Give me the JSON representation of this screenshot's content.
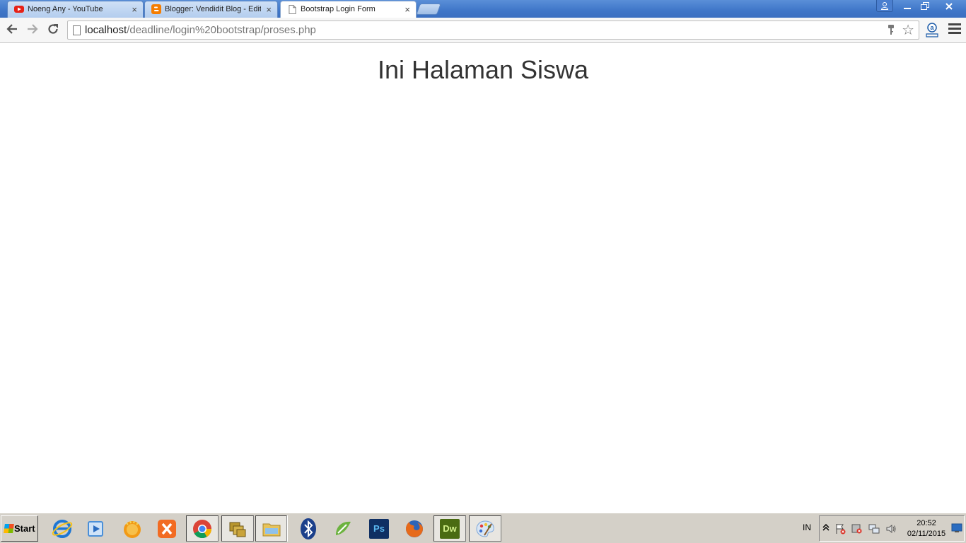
{
  "browser": {
    "tabs": [
      {
        "title": "Noeng Any - YouTube",
        "favicon": "youtube-icon",
        "active": false
      },
      {
        "title": "Blogger: Vendidit Blog - Edit e",
        "favicon": "blogger-icon",
        "active": false
      },
      {
        "title": "Bootstrap Login Form",
        "favicon": "page-icon",
        "active": true
      }
    ],
    "tab_close_glyph": "×",
    "address_bar": {
      "host": "localhost",
      "path": "/deadline/login%20bootstrap/proses.php"
    },
    "window_buttons": [
      "user-icon",
      "minimize-icon",
      "restore-icon",
      "close-icon"
    ]
  },
  "page": {
    "heading": "Ini Halaman Siswa"
  },
  "taskbar": {
    "start_label": "Start",
    "apps": [
      {
        "name": "internet-explorer-icon",
        "color": "#1e77d3",
        "label": "e"
      },
      {
        "name": "media-player-icon",
        "color": "#4a8fd8",
        "label": ""
      },
      {
        "name": "winamp-icon",
        "color": "#f29a16",
        "label": ""
      },
      {
        "name": "xampp-icon",
        "color": "#f26b22",
        "label": ""
      },
      {
        "name": "chrome-icon",
        "color": "#4285f4",
        "label": ""
      },
      {
        "name": "file-manager-icon",
        "color": "#b8962e",
        "label": ""
      },
      {
        "name": "explorer-folder-icon",
        "color": "#e7c35b",
        "label": ""
      },
      {
        "name": "bluetooth-icon",
        "color": "#1b3f8a",
        "label": "ᛒ"
      },
      {
        "name": "coreldraw-icon",
        "color": "#6cb33f",
        "label": ""
      },
      {
        "name": "photoshop-icon",
        "color": "#0f2f63",
        "label": "Ps"
      },
      {
        "name": "firefox-icon",
        "color": "#e76a1a",
        "label": ""
      },
      {
        "name": "dreamweaver-icon",
        "color": "#4a6b12",
        "label": "Dw"
      },
      {
        "name": "paint-icon",
        "color": "#7da7d9",
        "label": ""
      }
    ],
    "language": "IN",
    "clock": {
      "time": "20:52",
      "date": "02/11/2015"
    }
  }
}
